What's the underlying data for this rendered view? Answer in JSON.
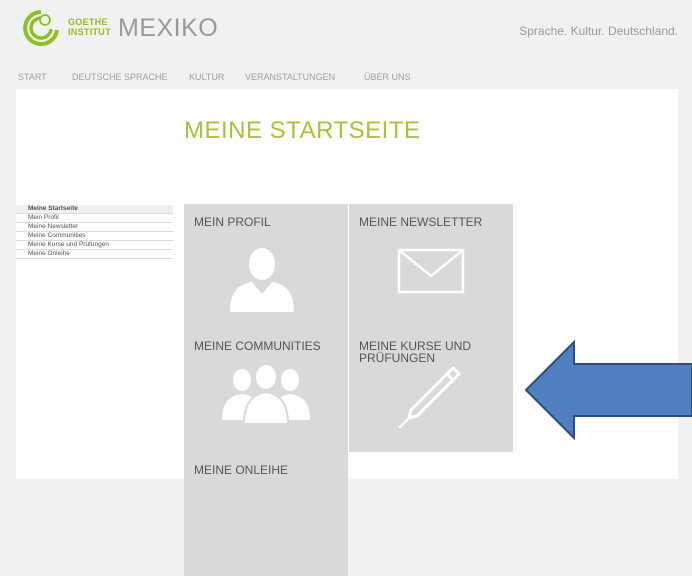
{
  "header": {
    "logo_line1": "GOETHE",
    "logo_line2": "INSTITUT",
    "site_title": "MEXIKO",
    "tagline": "Sprache. Kultur. Deutschland.",
    "brand_color": "#8fbf21"
  },
  "nav": {
    "items": [
      "START",
      "DEUTSCHE SPRACHE",
      "KULTUR",
      "VERANSTALTUNGEN",
      "ÜBER UNS"
    ]
  },
  "main": {
    "title": "MEINE STARTSEITE",
    "title_color": "#a6c436"
  },
  "sidebar": {
    "items": [
      {
        "label": "Meine Startseite",
        "active": true
      },
      {
        "label": "Mein Profil",
        "active": false
      },
      {
        "label": "Meine Newsletter",
        "active": false
      },
      {
        "label": "Meine Communities",
        "active": false
      },
      {
        "label": "Meine Kurse und Prüfungen",
        "active": false
      },
      {
        "label": "Meine Onleihe",
        "active": false
      }
    ]
  },
  "tiles": [
    {
      "label": "MEIN PROFIL",
      "icon": "person-icon"
    },
    {
      "label": "MEINE NEWSLETTER",
      "icon": "envelope-icon"
    },
    {
      "label": "MEINE COMMUNITIES",
      "icon": "group-icon"
    },
    {
      "label": "MEINE KURSE UND PRÜFUNGEN",
      "icon": "pencil-icon"
    },
    {
      "label": "MEINE ONLEIHE",
      "icon": ""
    }
  ],
  "annotation": {
    "arrow_color": "#4f7fc1",
    "arrow_icon": "left-arrow-annotation"
  }
}
